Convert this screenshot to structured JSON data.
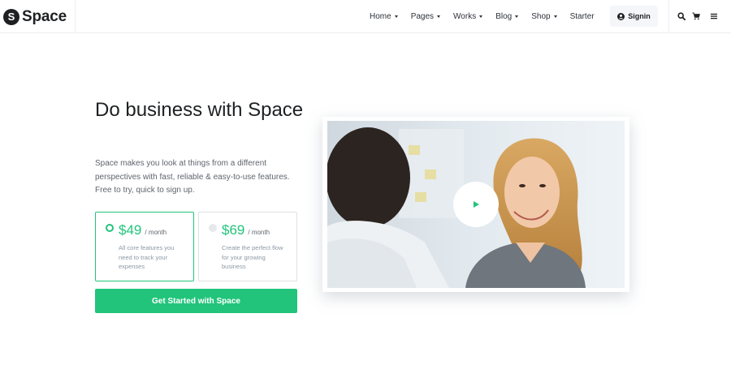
{
  "brand": {
    "mark": "S",
    "name": "Space"
  },
  "nav": {
    "items": [
      {
        "label": "Home",
        "dropdown": true
      },
      {
        "label": "Pages",
        "dropdown": true
      },
      {
        "label": "Works",
        "dropdown": true
      },
      {
        "label": "Blog",
        "dropdown": true
      },
      {
        "label": "Shop",
        "dropdown": true
      },
      {
        "label": "Starter",
        "dropdown": false
      }
    ],
    "signin_label": "Signin"
  },
  "icons": {
    "search": "search-icon",
    "cart": "cart-icon",
    "menu": "menu-icon",
    "user": "user-circle-icon",
    "play": "play-icon"
  },
  "hero": {
    "title": "Do business with Space",
    "description": "Space makes you look at things from a different perspectives with fast, reliable & easy-to-use features. Free to try, quick to sign up."
  },
  "plans": [
    {
      "price": "$49",
      "period": "/ month",
      "description": "All core features you need to track your expenses",
      "selected": true
    },
    {
      "price": "$69",
      "period": "/ month",
      "description": "Create the perfect flow for your growing business",
      "selected": false
    }
  ],
  "cta_label": "Get Started with Space",
  "colors": {
    "accent": "#22c47b",
    "text": "#1e2022",
    "muted": "#8c98a4"
  }
}
